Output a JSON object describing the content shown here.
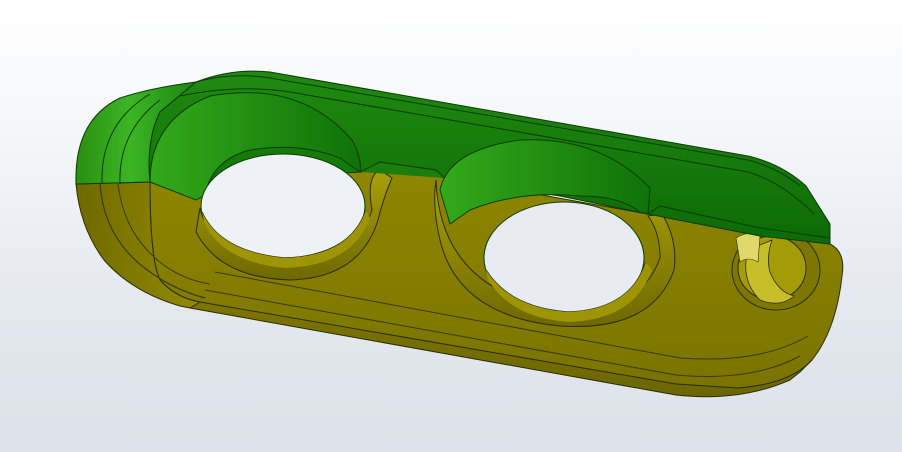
{
  "viewport": {
    "background_top": "#ffffff",
    "background_bottom": "#dde2ea"
  },
  "model": {
    "part": "cable-clamp-block",
    "holes": 3,
    "bodies": [
      {
        "name": "upper-half",
        "color": "#2e9a18",
        "shade": "#0f6a07"
      },
      {
        "name": "lower-half",
        "color": "#8a8200",
        "shade": "#5b5600"
      }
    ],
    "edge_color": "#1d2208"
  }
}
